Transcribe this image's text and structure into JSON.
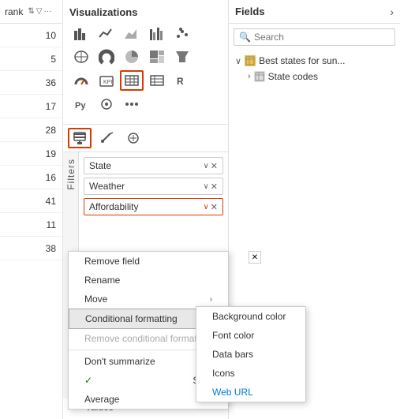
{
  "rank_panel": {
    "header_title": "rank",
    "rows": [
      "10",
      "5",
      "36",
      "17",
      "28",
      "19",
      "16",
      "41",
      "11",
      "38"
    ]
  },
  "visualizations": {
    "title": "Visualizations",
    "fields_title": "Fields",
    "search_placeholder": "Search"
  },
  "filters": {
    "label": "Filters",
    "pills": [
      {
        "label": "State",
        "highlighted": false
      },
      {
        "label": "Weather",
        "highlighted": false
      },
      {
        "label": "Affordability",
        "highlighted": true
      }
    ]
  },
  "values_label": "Values",
  "field_tree": [
    {
      "label": "Best states for sun...",
      "type": "table-yellow",
      "expanded": true
    },
    {
      "label": "State codes",
      "type": "table-gray",
      "expanded": false
    }
  ],
  "context_menu": {
    "items": [
      {
        "label": "Remove field",
        "disabled": false
      },
      {
        "label": "Rename",
        "disabled": false
      },
      {
        "label": "Move",
        "disabled": false,
        "has_arrow": true
      },
      {
        "label": "Conditional formatting",
        "disabled": false,
        "has_arrow": true,
        "highlighted": true
      },
      {
        "label": "Remove conditional formatting",
        "disabled": true
      },
      {
        "label": "Don't summarize",
        "disabled": false
      },
      {
        "label": "Sum",
        "disabled": false,
        "has_check": true
      },
      {
        "label": "Average",
        "disabled": false
      }
    ]
  },
  "submenu": {
    "items": [
      {
        "label": "Background color"
      },
      {
        "label": "Font color"
      },
      {
        "label": "Data bars"
      },
      {
        "label": "Icons"
      },
      {
        "label": "Web URL"
      }
    ]
  }
}
